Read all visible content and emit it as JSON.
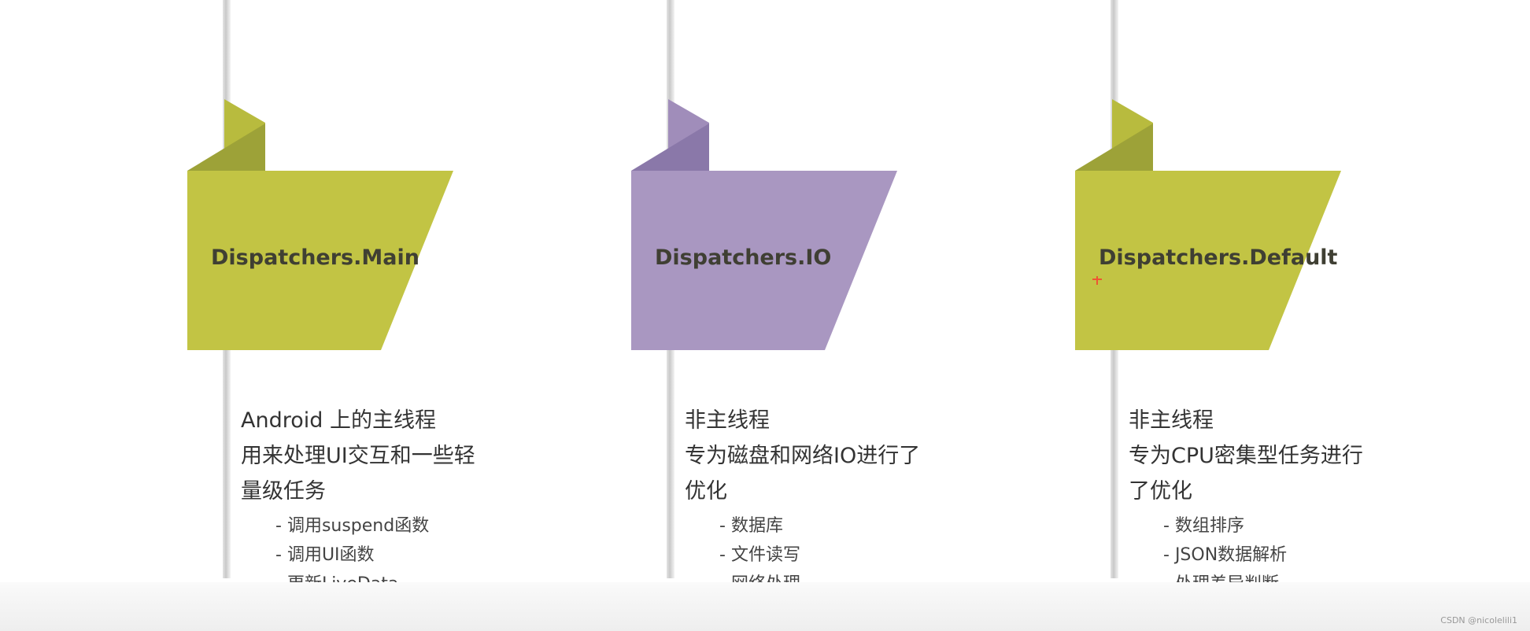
{
  "panels": [
    {
      "title": "Dispatchers.Main",
      "color": "#c2c444",
      "fold": "#9da238",
      "tab": "#b8bb3e",
      "desc": [
        "Android 上的主线程",
        "用来处理UI交互和一些轻",
        "量级任务"
      ],
      "items": [
        "调用suspend函数",
        "调用UI函数",
        "更新LiveData"
      ]
    },
    {
      "title": "Dispatchers.IO",
      "color": "#a997c1",
      "fold": "#8a78a9",
      "tab": "#a08dba",
      "desc": [
        "非主线程",
        "专为磁盘和网络IO进行了",
        "优化"
      ],
      "items": [
        "数据库",
        "文件读写",
        "网络处理"
      ]
    },
    {
      "title": "Dispatchers.Default",
      "color": "#c2c444",
      "fold": "#9da238",
      "tab": "#b8bb3e",
      "desc": [
        "非主线程",
        "专为CPU密集型任务进行",
        "了优化"
      ],
      "items": [
        "数组排序",
        "JSON数据解析",
        "处理差异判断"
      ]
    }
  ],
  "watermark": "CSDN @nicolelili1"
}
